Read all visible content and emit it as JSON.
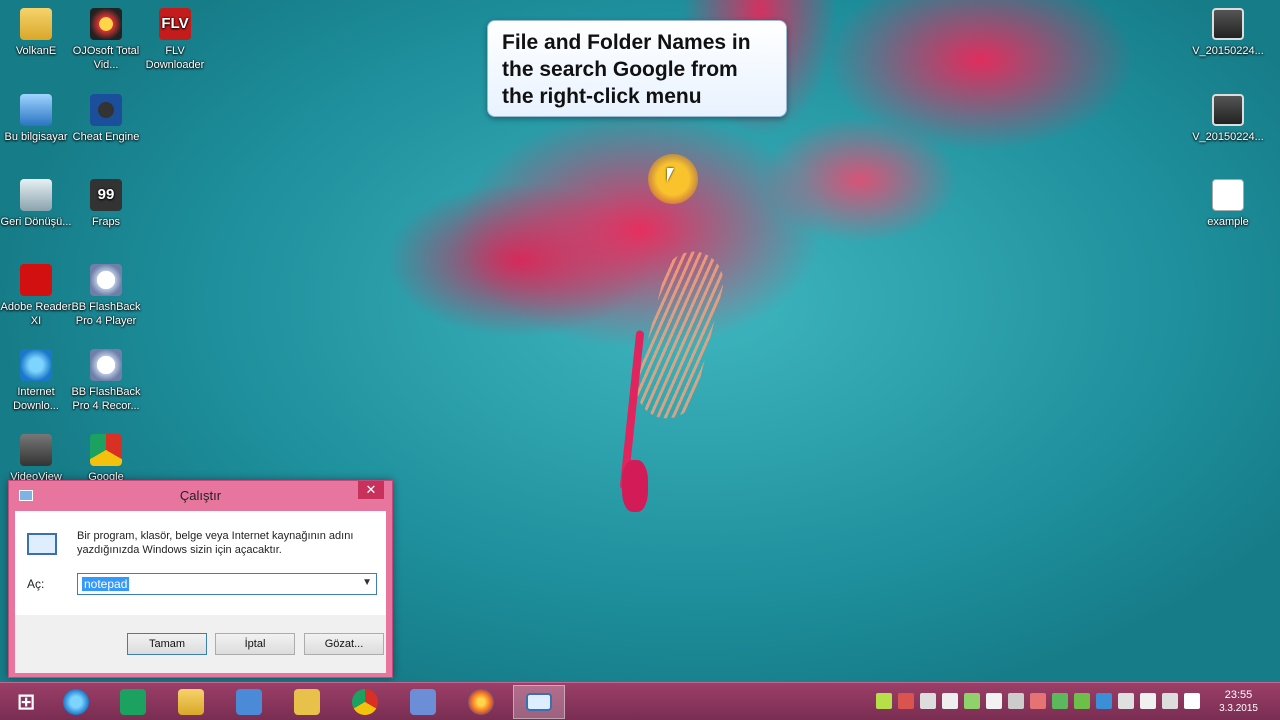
{
  "desktop": {
    "left_icons": [
      {
        "label": "VolkanE",
        "icon": "folder-icon"
      },
      {
        "label": "OJOsoft Total Vid...",
        "icon": "ojosoft-icon"
      },
      {
        "label": "FLV Downloader",
        "icon": "flv-icon",
        "glyph": "FLV"
      },
      {
        "label": "Bu bilgisayar",
        "icon": "computer-icon"
      },
      {
        "label": "Cheat Engine",
        "icon": "cheat-engine-icon"
      },
      {
        "label": "Geri Dönüşü...",
        "icon": "recycle-bin-icon"
      },
      {
        "label": "Fraps",
        "icon": "fraps-icon",
        "glyph": "99"
      },
      {
        "label": "Adobe Reader XI",
        "icon": "adobe-reader-icon"
      },
      {
        "label": "BB FlashBack Pro 4 Player",
        "icon": "bb-flashback-player-icon"
      },
      {
        "label": "Internet Downlo...",
        "icon": "internet-download-icon"
      },
      {
        "label": "BB FlashBack Pro 4 Recor...",
        "icon": "bb-flashback-recorder-icon"
      },
      {
        "label": "VideoView",
        "icon": "video-view-icon"
      },
      {
        "label": "Google",
        "icon": "chrome-icon"
      }
    ],
    "right_icons": [
      {
        "label": "V_20150224...",
        "icon": "video-thumbnail-icon"
      },
      {
        "label": "V_20150224...",
        "icon": "video-thumbnail-icon"
      },
      {
        "label": "example",
        "icon": "text-file-icon"
      }
    ]
  },
  "callout": {
    "text": "File and Folder Names in\nthe search Google from\nthe right-click menu"
  },
  "run_dialog": {
    "title": "Çalıştır",
    "close": "✕",
    "description": "Bir program, klasör, belge veya Internet kaynağının adını yazdığınızda Windows sizin için açacaktır.",
    "open_label": "Aç:",
    "open_value": "notepad",
    "ok_button": "Tamam",
    "cancel_button": "İptal",
    "browse_button": "Gözat..."
  },
  "taskbar": {
    "items": [
      {
        "name": "start-button",
        "icon": "windows-logo-icon"
      },
      {
        "name": "internet-explorer",
        "icon": "ie-icon"
      },
      {
        "name": "store",
        "icon": "store-icon"
      },
      {
        "name": "file-explorer",
        "icon": "folder-icon"
      },
      {
        "name": "control-panel",
        "icon": "control-panel-icon"
      },
      {
        "name": "tool-app",
        "icon": "tool-icon"
      },
      {
        "name": "chrome",
        "icon": "chrome-icon"
      },
      {
        "name": "package-app",
        "icon": "package-icon"
      },
      {
        "name": "firefox",
        "icon": "firefox-icon"
      },
      {
        "name": "run-dialog",
        "icon": "run-icon",
        "active": true
      }
    ],
    "clock": {
      "time": "23:55",
      "date": "3.3.2015"
    }
  }
}
